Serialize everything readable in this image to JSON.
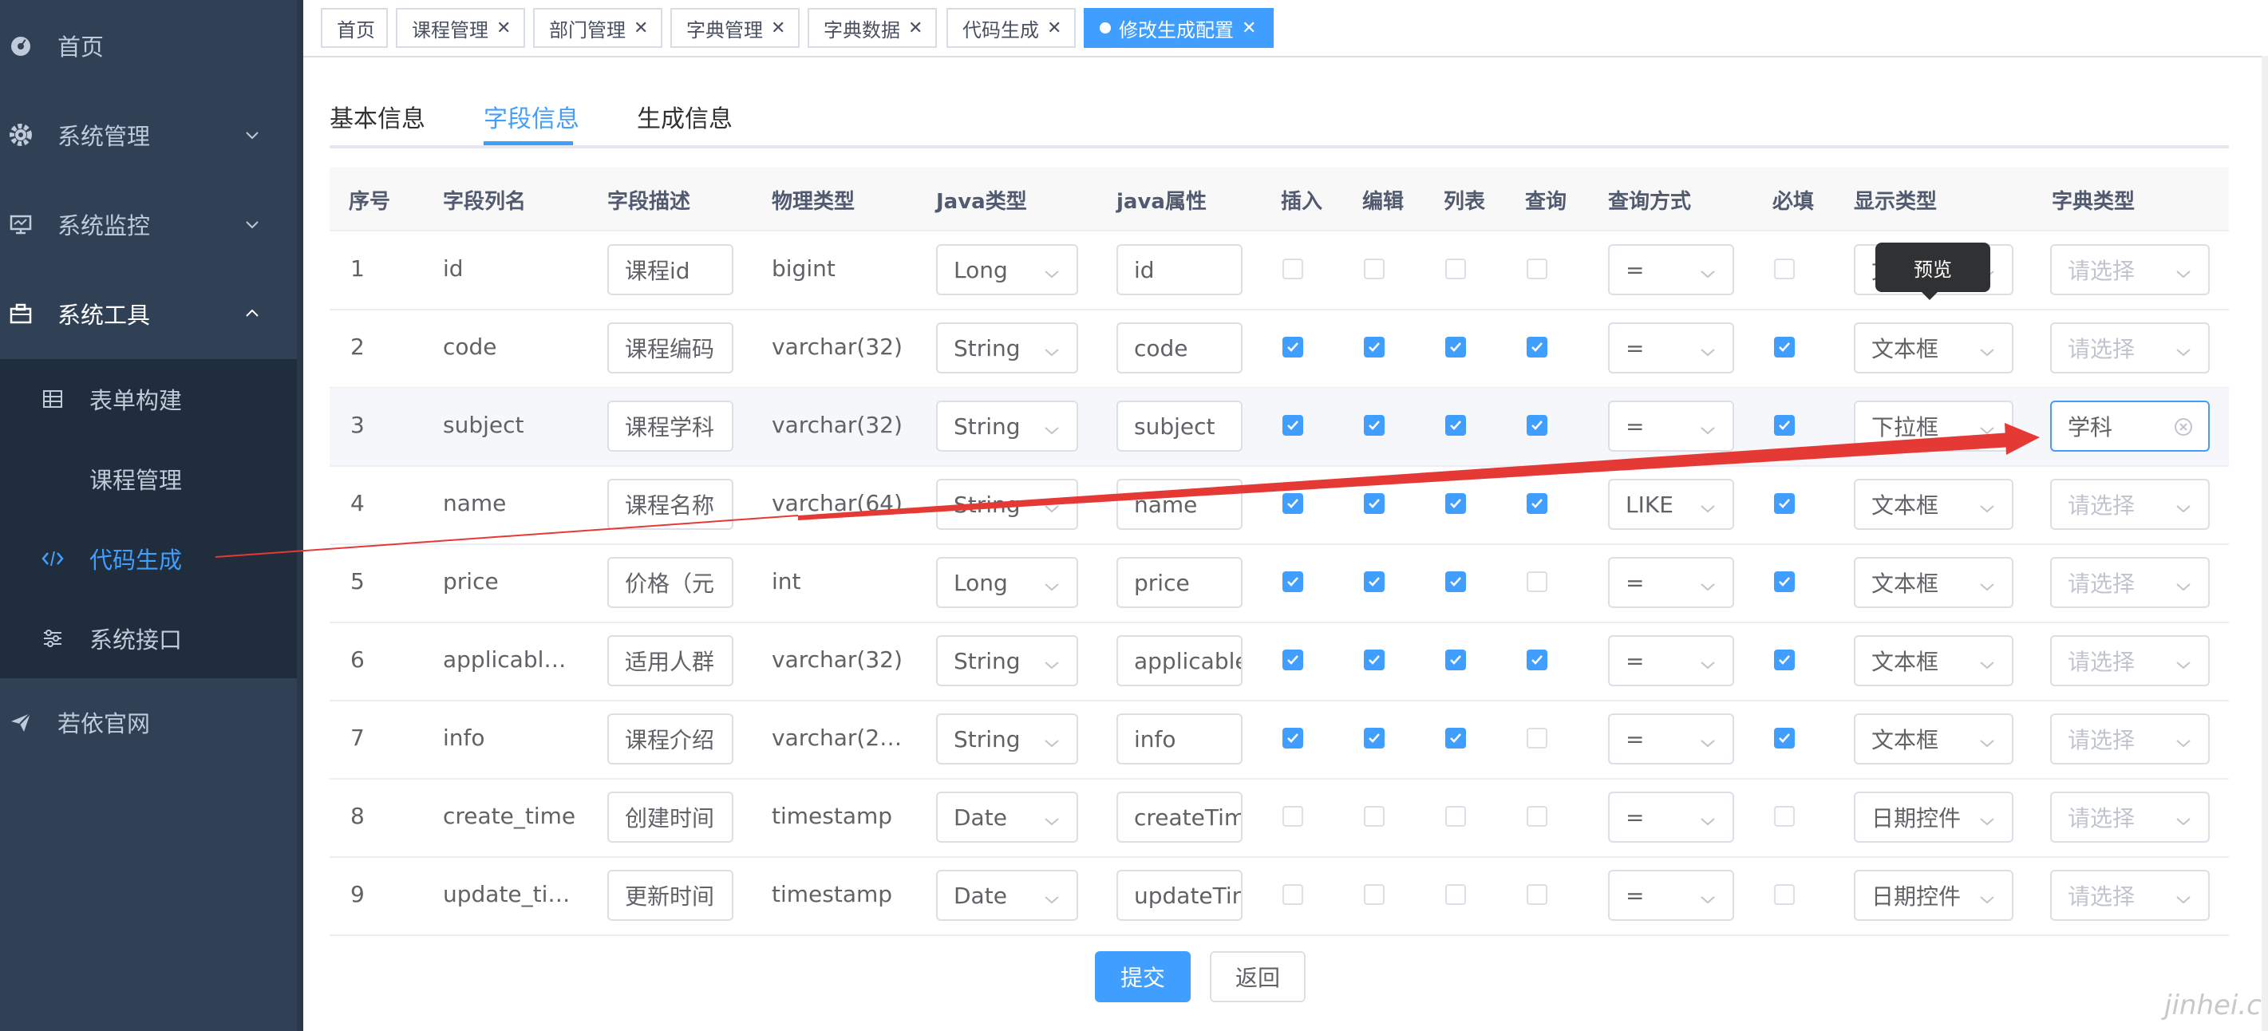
{
  "sidebar": {
    "items": [
      {
        "label": "首页",
        "icon": "dashboard-icon"
      },
      {
        "label": "系统管理",
        "icon": "gear-icon"
      },
      {
        "label": "系统监控",
        "icon": "monitor-icon"
      },
      {
        "label": "系统工具",
        "icon": "toolbox-icon"
      },
      {
        "label": "若依官网",
        "icon": "send-icon"
      }
    ],
    "submenu": [
      {
        "label": "表单构建",
        "icon": "table-icon"
      },
      {
        "label": "课程管理",
        "icon": ""
      },
      {
        "label": "代码生成",
        "icon": "code-icon"
      },
      {
        "label": "系统接口",
        "icon": "sliders-icon"
      }
    ]
  },
  "tags": [
    {
      "label": "首页"
    },
    {
      "label": "课程管理"
    },
    {
      "label": "部门管理"
    },
    {
      "label": "字典管理"
    },
    {
      "label": "字典数据"
    },
    {
      "label": "代码生成"
    },
    {
      "label": "修改生成配置"
    }
  ],
  "tabs": [
    "基本信息",
    "字段信息",
    "生成信息"
  ],
  "table": {
    "headers": [
      "序号",
      "字段列名",
      "字段描述",
      "物理类型",
      "Java类型",
      "java属性",
      "插入",
      "编辑",
      "列表",
      "查询",
      "查询方式",
      "必填",
      "显示类型",
      "字典类型"
    ],
    "rows": [
      {
        "no": "1",
        "column": "id",
        "desc": "课程id",
        "phys": "bigint",
        "javaType": "Long",
        "javaProp": "id",
        "insert": false,
        "edit": false,
        "list": false,
        "query": false,
        "queryType": "=",
        "required": false,
        "htmlType": "文本框",
        "dict": "请选择"
      },
      {
        "no": "2",
        "column": "code",
        "desc": "课程编码",
        "phys": "varchar(32)",
        "javaType": "String",
        "javaProp": "code",
        "insert": true,
        "edit": true,
        "list": true,
        "query": true,
        "queryType": "=",
        "required": true,
        "htmlType": "文本框",
        "dict": "请选择"
      },
      {
        "no": "3",
        "column": "subject",
        "desc": "课程学科",
        "phys": "varchar(32)",
        "javaType": "String",
        "javaProp": "subject",
        "insert": true,
        "edit": true,
        "list": true,
        "query": true,
        "queryType": "=",
        "required": true,
        "htmlType": "下拉框",
        "dict": "学科"
      },
      {
        "no": "4",
        "column": "name",
        "desc": "课程名称",
        "phys": "varchar(64)",
        "javaType": "String",
        "javaProp": "name",
        "insert": true,
        "edit": true,
        "list": true,
        "query": true,
        "queryType": "LIKE",
        "required": true,
        "htmlType": "文本框",
        "dict": "请选择"
      },
      {
        "no": "5",
        "column": "price",
        "desc": "价格（元",
        "phys": "int",
        "javaType": "Long",
        "javaProp": "price",
        "insert": true,
        "edit": true,
        "list": true,
        "query": false,
        "queryType": "=",
        "required": true,
        "htmlType": "文本框",
        "dict": "请选择"
      },
      {
        "no": "6",
        "column": "applicabl…",
        "desc": "适用人群",
        "phys": "varchar(32)",
        "javaType": "String",
        "javaProp": "applicable",
        "insert": true,
        "edit": true,
        "list": true,
        "query": true,
        "queryType": "=",
        "required": true,
        "htmlType": "文本框",
        "dict": "请选择"
      },
      {
        "no": "7",
        "column": "info",
        "desc": "课程介绍",
        "phys": "varchar(2…",
        "javaType": "String",
        "javaProp": "info",
        "insert": true,
        "edit": true,
        "list": true,
        "query": false,
        "queryType": "=",
        "required": true,
        "htmlType": "文本框",
        "dict": "请选择"
      },
      {
        "no": "8",
        "column": "create_time",
        "desc": "创建时间",
        "phys": "timestamp",
        "javaType": "Date",
        "javaProp": "createTim",
        "insert": false,
        "edit": false,
        "list": false,
        "query": false,
        "queryType": "=",
        "required": false,
        "htmlType": "日期控件",
        "dict": "请选择"
      },
      {
        "no": "9",
        "column": "update_ti…",
        "desc": "更新时间",
        "phys": "timestamp",
        "javaType": "Date",
        "javaProp": "updateTin",
        "insert": false,
        "edit": false,
        "list": false,
        "query": false,
        "queryType": "=",
        "required": false,
        "htmlType": "日期控件",
        "dict": "请选择"
      }
    ]
  },
  "tooltip": "预览",
  "buttons": {
    "submit": "提交",
    "back": "返回"
  },
  "watermark": "jinhei.cn",
  "colors": {
    "sidebar": "#304156",
    "submenu": "#1f2d3d",
    "accent": "#409eff",
    "annotation_arrow": "#e53935"
  }
}
